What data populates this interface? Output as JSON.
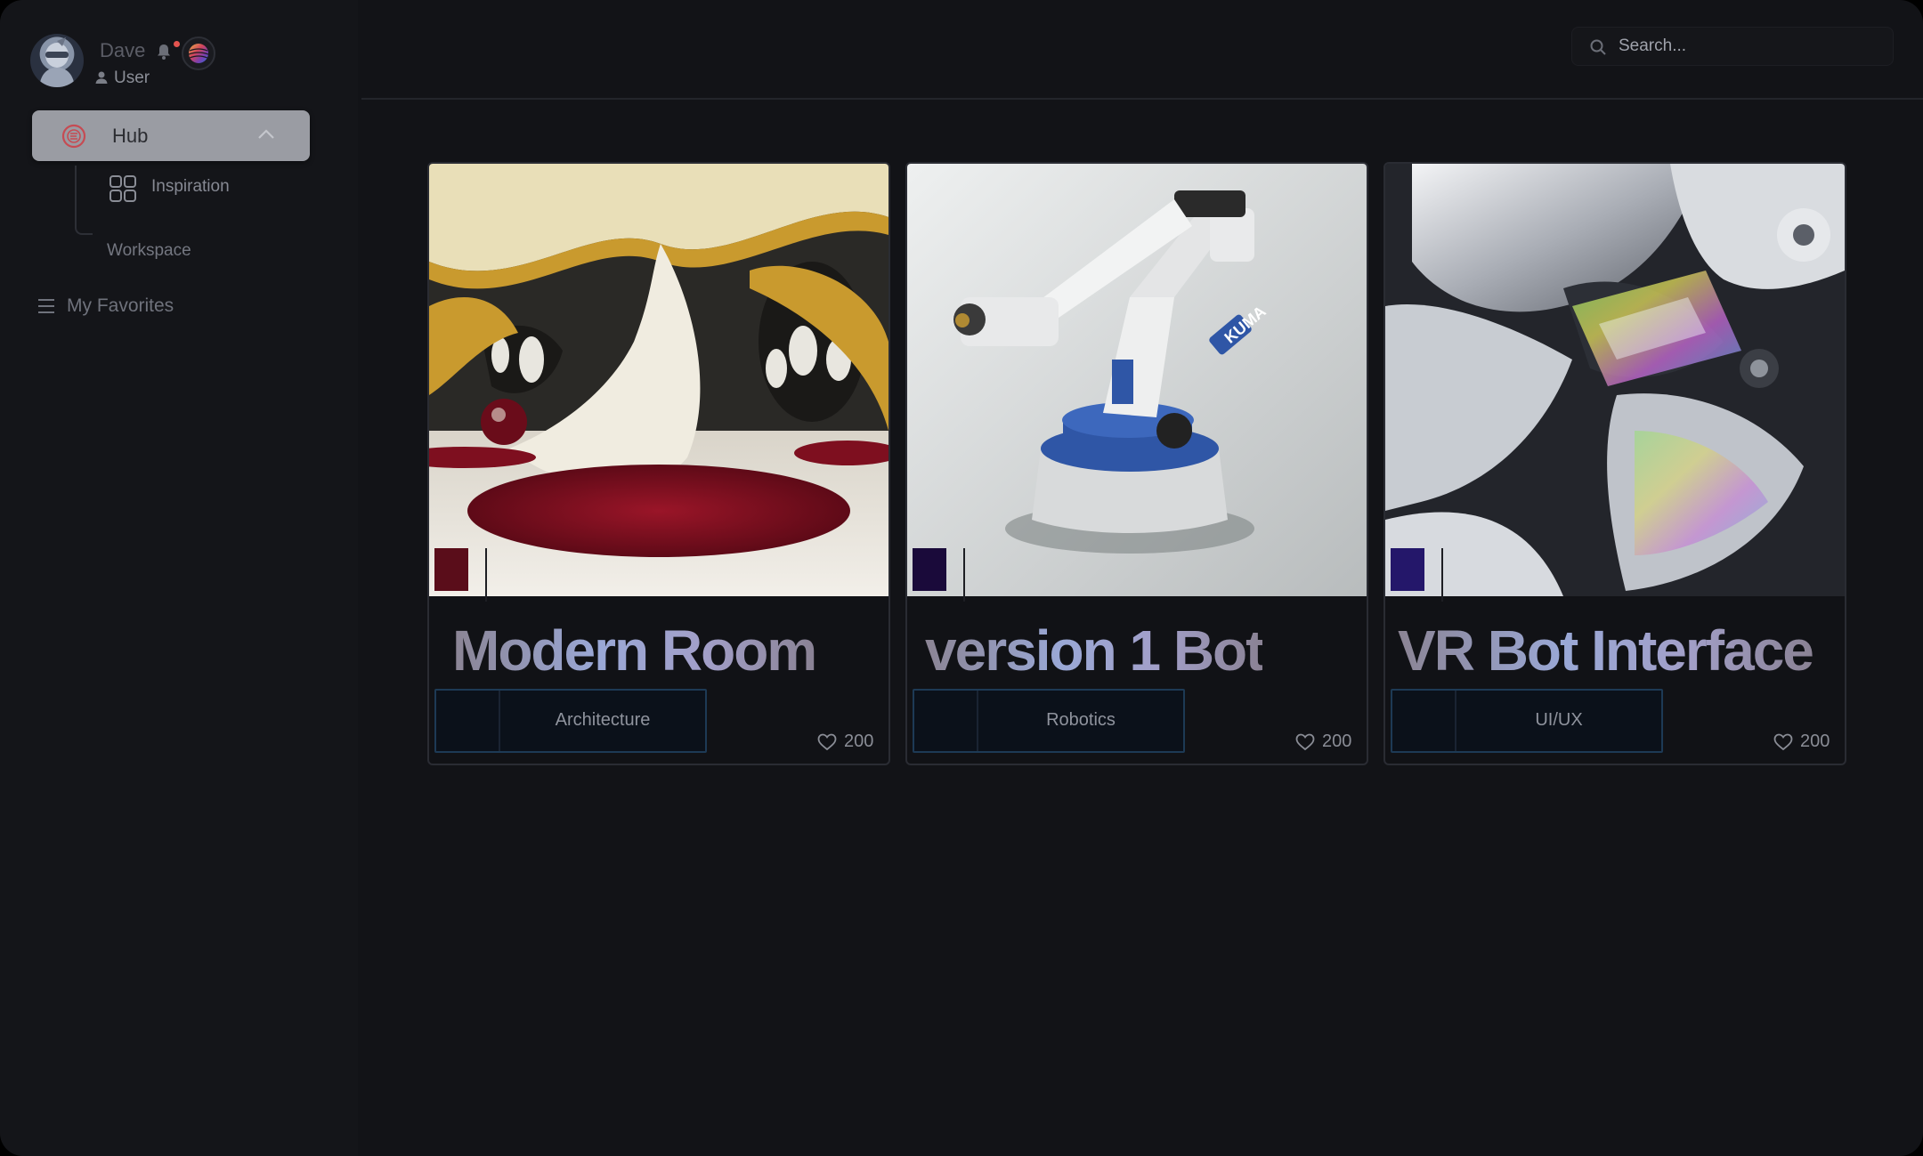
{
  "user": {
    "name": "Dave",
    "role": "User",
    "has_notification": true
  },
  "sidebar": {
    "hub": {
      "label": "Hub",
      "expanded": true
    },
    "children": [
      {
        "label": "Inspiration",
        "icon": "grid-icon"
      },
      {
        "label": "Workspace"
      }
    ],
    "favorites": {
      "label": "My Favorites",
      "icon": "menu-icon"
    }
  },
  "search": {
    "placeholder": "Search...",
    "value": ""
  },
  "cards": [
    {
      "title": "Modern Room",
      "tag": "Architecture",
      "likes": "200",
      "swatch_color": "#5a0d1a",
      "image": "futuristic interior with red round rug"
    },
    {
      "title": "version 1 Bot",
      "tag": "Robotics",
      "likes": "200",
      "swatch_color": "#1a0a3a",
      "image": "white and blue industrial robot arm"
    },
    {
      "title": "VR Bot Interface",
      "tag": "UI/UX",
      "likes": "200",
      "swatch_color": "#24176a",
      "image": "chrome humanoid robot closeup"
    }
  ],
  "colors": {
    "background": "#121317",
    "sidebar": "#141519",
    "hub_highlight": "#9a9ca3",
    "tag_border": "#1d3a55",
    "notification": "#e4544f"
  }
}
